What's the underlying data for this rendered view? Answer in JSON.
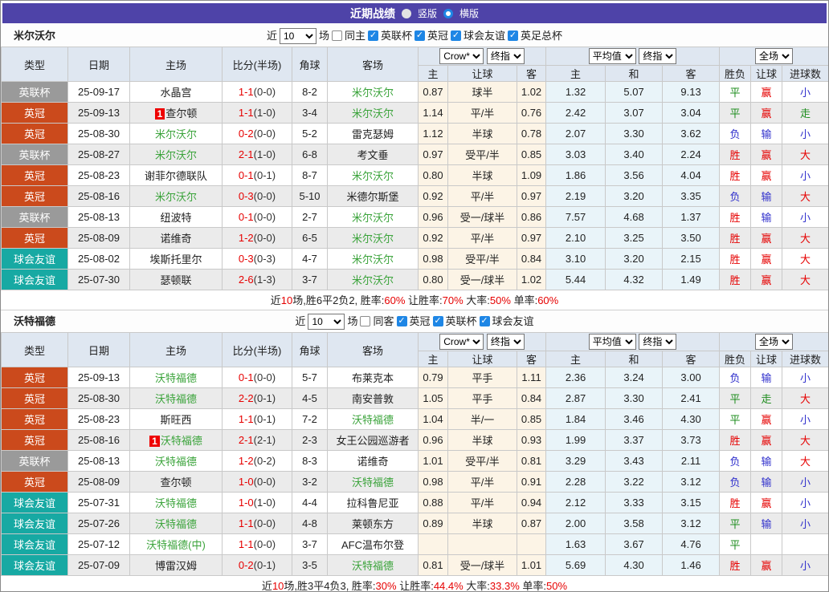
{
  "title_bar": {
    "title": "近期战绩",
    "radio_vertical": "竖版",
    "radio_horizontal": "横版"
  },
  "table_header": {
    "left_cols": [
      "类型",
      "日期",
      "主场",
      "比分(半场)",
      "角球",
      "客场"
    ],
    "handicap_selects": [
      "Crow*",
      "终指"
    ],
    "europe_selects": [
      "平均值",
      "终指"
    ],
    "scope_select": "全场",
    "sub_cols": [
      "主",
      "让球",
      "客",
      "主",
      "和",
      "客",
      "胜负",
      "让球",
      "进球数"
    ]
  },
  "colors": {
    "type_badges": {
      "英联杯": "#9A9A9A",
      "英冠": "#CB4A1C",
      "球会友谊": "#17A9A3"
    },
    "result": {
      "r": "#E60000",
      "g": "#1D8C1D",
      "b": "#3030CC"
    },
    "team_green": "#3AA33A",
    "score_red": "#E60000",
    "accent_purple": "#4E43A8"
  },
  "sections": [
    {
      "team": "米尔沃尔",
      "filter": {
        "near": "近",
        "count": "10",
        "games": "场",
        "same": "同主",
        "competitions": [
          "英联杯",
          "英冠",
          "球会友谊",
          "英足总杯"
        ]
      },
      "rows": [
        {
          "type": "英联杯",
          "date": "25-09-17",
          "home": "水晶宫",
          "home_focus": false,
          "home_badge": null,
          "score": "1-1",
          "half": "(0-0)",
          "corner": "8-2",
          "away": "米尔沃尔",
          "away_focus": true,
          "odds": [
            "0.87",
            "球半",
            "1.02"
          ],
          "euro": [
            "1.32",
            "5.07",
            "9.13"
          ],
          "results": [
            [
              "平",
              "g"
            ],
            [
              "赢",
              "r"
            ],
            [
              "小",
              "b"
            ]
          ]
        },
        {
          "type": "英冠",
          "date": "25-09-13",
          "home": "查尔顿",
          "home_focus": false,
          "home_badge": "1",
          "score": "1-1",
          "half": "(1-0)",
          "corner": "3-4",
          "away": "米尔沃尔",
          "away_focus": true,
          "odds": [
            "1.14",
            "平/半",
            "0.76"
          ],
          "euro": [
            "2.42",
            "3.07",
            "3.04"
          ],
          "results": [
            [
              "平",
              "g"
            ],
            [
              "赢",
              "r"
            ],
            [
              "走",
              "g"
            ]
          ]
        },
        {
          "type": "英冠",
          "date": "25-08-30",
          "home": "米尔沃尔",
          "home_focus": true,
          "home_badge": null,
          "score": "0-2",
          "half": "(0-0)",
          "corner": "5-2",
          "away": "雷克瑟姆",
          "away_focus": false,
          "odds": [
            "1.12",
            "半球",
            "0.78"
          ],
          "euro": [
            "2.07",
            "3.30",
            "3.62"
          ],
          "results": [
            [
              "负",
              "b"
            ],
            [
              "输",
              "b"
            ],
            [
              "小",
              "b"
            ]
          ]
        },
        {
          "type": "英联杯",
          "date": "25-08-27",
          "home": "米尔沃尔",
          "home_focus": true,
          "home_badge": null,
          "score": "2-1",
          "half": "(1-0)",
          "corner": "6-8",
          "away": "考文垂",
          "away_focus": false,
          "odds": [
            "0.97",
            "受平/半",
            "0.85"
          ],
          "euro": [
            "3.03",
            "3.40",
            "2.24"
          ],
          "results": [
            [
              "胜",
              "r"
            ],
            [
              "赢",
              "r"
            ],
            [
              "大",
              "r"
            ]
          ]
        },
        {
          "type": "英冠",
          "date": "25-08-23",
          "home": "谢菲尔德联队",
          "home_focus": false,
          "home_badge": null,
          "score": "0-1",
          "half": "(0-1)",
          "corner": "8-7",
          "away": "米尔沃尔",
          "away_focus": true,
          "odds": [
            "0.80",
            "半球",
            "1.09"
          ],
          "euro": [
            "1.86",
            "3.56",
            "4.04"
          ],
          "results": [
            [
              "胜",
              "r"
            ],
            [
              "赢",
              "r"
            ],
            [
              "小",
              "b"
            ]
          ]
        },
        {
          "type": "英冠",
          "date": "25-08-16",
          "home": "米尔沃尔",
          "home_focus": true,
          "home_badge": null,
          "score": "0-3",
          "half": "(0-0)",
          "corner": "5-10",
          "away": "米德尔斯堡",
          "away_focus": false,
          "odds": [
            "0.92",
            "平/半",
            "0.97"
          ],
          "euro": [
            "2.19",
            "3.20",
            "3.35"
          ],
          "results": [
            [
              "负",
              "b"
            ],
            [
              "输",
              "b"
            ],
            [
              "大",
              "r"
            ]
          ]
        },
        {
          "type": "英联杯",
          "date": "25-08-13",
          "home": "纽波特",
          "home_focus": false,
          "home_badge": null,
          "score": "0-1",
          "half": "(0-0)",
          "corner": "2-7",
          "away": "米尔沃尔",
          "away_focus": true,
          "odds": [
            "0.96",
            "受一/球半",
            "0.86"
          ],
          "euro": [
            "7.57",
            "4.68",
            "1.37"
          ],
          "results": [
            [
              "胜",
              "r"
            ],
            [
              "输",
              "b"
            ],
            [
              "小",
              "b"
            ]
          ]
        },
        {
          "type": "英冠",
          "date": "25-08-09",
          "home": "诺维奇",
          "home_focus": false,
          "home_badge": null,
          "score": "1-2",
          "half": "(0-0)",
          "corner": "6-5",
          "away": "米尔沃尔",
          "away_focus": true,
          "odds": [
            "0.92",
            "平/半",
            "0.97"
          ],
          "euro": [
            "2.10",
            "3.25",
            "3.50"
          ],
          "results": [
            [
              "胜",
              "r"
            ],
            [
              "赢",
              "r"
            ],
            [
              "大",
              "r"
            ]
          ]
        },
        {
          "type": "球会友谊",
          "date": "25-08-02",
          "home": "埃斯托里尔",
          "home_focus": false,
          "home_badge": null,
          "score": "0-3",
          "half": "(0-3)",
          "corner": "4-7",
          "away": "米尔沃尔",
          "away_focus": true,
          "odds": [
            "0.98",
            "受平/半",
            "0.84"
          ],
          "euro": [
            "3.10",
            "3.20",
            "2.15"
          ],
          "results": [
            [
              "胜",
              "r"
            ],
            [
              "赢",
              "r"
            ],
            [
              "大",
              "r"
            ]
          ]
        },
        {
          "type": "球会友谊",
          "date": "25-07-30",
          "home": "瑟顿联",
          "home_focus": false,
          "home_badge": null,
          "score": "2-6",
          "half": "(1-3)",
          "corner": "3-7",
          "away": "米尔沃尔",
          "away_focus": true,
          "odds": [
            "0.80",
            "受一/球半",
            "1.02"
          ],
          "euro": [
            "5.44",
            "4.32",
            "1.49"
          ],
          "results": [
            [
              "胜",
              "r"
            ],
            [
              "赢",
              "r"
            ],
            [
              "大",
              "r"
            ]
          ]
        }
      ],
      "summary": [
        [
          "近",
          0
        ],
        [
          "10",
          1
        ],
        [
          "场,胜6平2负2, 胜率:",
          0
        ],
        [
          "60%",
          1
        ],
        [
          " 让胜率:",
          0
        ],
        [
          "70%",
          1
        ],
        [
          " 大率:",
          0
        ],
        [
          "50%",
          1
        ],
        [
          " 单率:",
          0
        ],
        [
          "60%",
          1
        ]
      ]
    },
    {
      "team": "沃特福德",
      "filter": {
        "near": "近",
        "count": "10",
        "games": "场",
        "same": "同客",
        "competitions": [
          "英冠",
          "英联杯",
          "球会友谊"
        ]
      },
      "rows": [
        {
          "type": "英冠",
          "date": "25-09-13",
          "home": "沃特福德",
          "home_focus": true,
          "home_badge": null,
          "score": "0-1",
          "half": "(0-0)",
          "corner": "5-7",
          "away": "布莱克本",
          "away_focus": false,
          "odds": [
            "0.79",
            "平手",
            "1.11"
          ],
          "euro": [
            "2.36",
            "3.24",
            "3.00"
          ],
          "results": [
            [
              "负",
              "b"
            ],
            [
              "输",
              "b"
            ],
            [
              "小",
              "b"
            ]
          ]
        },
        {
          "type": "英冠",
          "date": "25-08-30",
          "home": "沃特福德",
          "home_focus": true,
          "home_badge": null,
          "score": "2-2",
          "half": "(0-1)",
          "corner": "4-5",
          "away": "南安普敦",
          "away_focus": false,
          "odds": [
            "1.05",
            "平手",
            "0.84"
          ],
          "euro": [
            "2.87",
            "3.30",
            "2.41"
          ],
          "results": [
            [
              "平",
              "g"
            ],
            [
              "走",
              "g"
            ],
            [
              "大",
              "r"
            ]
          ]
        },
        {
          "type": "英冠",
          "date": "25-08-23",
          "home": "斯旺西",
          "home_focus": false,
          "home_badge": null,
          "score": "1-1",
          "half": "(0-1)",
          "corner": "7-2",
          "away": "沃特福德",
          "away_focus": true,
          "odds": [
            "1.04",
            "半/一",
            "0.85"
          ],
          "euro": [
            "1.84",
            "3.46",
            "4.30"
          ],
          "results": [
            [
              "平",
              "g"
            ],
            [
              "赢",
              "r"
            ],
            [
              "小",
              "b"
            ]
          ]
        },
        {
          "type": "英冠",
          "date": "25-08-16",
          "home": "沃特福德",
          "home_focus": true,
          "home_badge": "1",
          "score": "2-1",
          "half": "(2-1)",
          "corner": "2-3",
          "away": "女王公园巡游者",
          "away_focus": false,
          "odds": [
            "0.96",
            "半球",
            "0.93"
          ],
          "euro": [
            "1.99",
            "3.37",
            "3.73"
          ],
          "results": [
            [
              "胜",
              "r"
            ],
            [
              "赢",
              "r"
            ],
            [
              "大",
              "r"
            ]
          ]
        },
        {
          "type": "英联杯",
          "date": "25-08-13",
          "home": "沃特福德",
          "home_focus": true,
          "home_badge": null,
          "score": "1-2",
          "half": "(0-2)",
          "corner": "8-3",
          "away": "诺维奇",
          "away_focus": false,
          "odds": [
            "1.01",
            "受平/半",
            "0.81"
          ],
          "euro": [
            "3.29",
            "3.43",
            "2.11"
          ],
          "results": [
            [
              "负",
              "b"
            ],
            [
              "输",
              "b"
            ],
            [
              "大",
              "r"
            ]
          ]
        },
        {
          "type": "英冠",
          "date": "25-08-09",
          "home": "查尔顿",
          "home_focus": false,
          "home_badge": null,
          "score": "1-0",
          "half": "(0-0)",
          "corner": "3-2",
          "away": "沃特福德",
          "away_focus": true,
          "odds": [
            "0.98",
            "平/半",
            "0.91"
          ],
          "euro": [
            "2.28",
            "3.22",
            "3.12"
          ],
          "results": [
            [
              "负",
              "b"
            ],
            [
              "输",
              "b"
            ],
            [
              "小",
              "b"
            ]
          ]
        },
        {
          "type": "球会友谊",
          "date": "25-07-31",
          "home": "沃特福德",
          "home_focus": true,
          "home_badge": null,
          "score": "1-0",
          "half": "(1-0)",
          "corner": "4-4",
          "away": "拉科鲁尼亚",
          "away_focus": false,
          "odds": [
            "0.88",
            "平/半",
            "0.94"
          ],
          "euro": [
            "2.12",
            "3.33",
            "3.15"
          ],
          "results": [
            [
              "胜",
              "r"
            ],
            [
              "赢",
              "r"
            ],
            [
              "小",
              "b"
            ]
          ]
        },
        {
          "type": "球会友谊",
          "date": "25-07-26",
          "home": "沃特福德",
          "home_focus": true,
          "home_badge": null,
          "score": "1-1",
          "half": "(0-0)",
          "corner": "4-8",
          "away": "莱顿东方",
          "away_focus": false,
          "odds": [
            "0.89",
            "半球",
            "0.87"
          ],
          "euro": [
            "2.00",
            "3.58",
            "3.12"
          ],
          "results": [
            [
              "平",
              "g"
            ],
            [
              "输",
              "b"
            ],
            [
              "小",
              "b"
            ]
          ]
        },
        {
          "type": "球会友谊",
          "date": "25-07-12",
          "home": "沃特福德(中)",
          "home_focus": true,
          "home_badge": null,
          "score": "1-1",
          "half": "(0-0)",
          "corner": "3-7",
          "away": "AFC温布尔登",
          "away_focus": false,
          "odds": [
            "",
            "",
            ""
          ],
          "euro": [
            "1.63",
            "3.67",
            "4.76"
          ],
          "results": [
            [
              "平",
              "g"
            ],
            [
              "",
              ""
            ],
            [
              "",
              ""
            ]
          ]
        },
        {
          "type": "球会友谊",
          "date": "25-07-09",
          "home": "博雷汉姆",
          "home_focus": false,
          "home_badge": null,
          "score": "0-2",
          "half": "(0-1)",
          "corner": "3-5",
          "away": "沃特福德",
          "away_focus": true,
          "odds": [
            "0.81",
            "受一/球半",
            "1.01"
          ],
          "euro": [
            "5.69",
            "4.30",
            "1.46"
          ],
          "results": [
            [
              "胜",
              "r"
            ],
            [
              "赢",
              "r"
            ],
            [
              "小",
              "b"
            ]
          ]
        }
      ],
      "summary": [
        [
          "近",
          0
        ],
        [
          "10",
          1
        ],
        [
          "场,胜3平4负3, 胜率:",
          0
        ],
        [
          "30%",
          1
        ],
        [
          " 让胜率:",
          0
        ],
        [
          "44.4%",
          1
        ],
        [
          " 大率:",
          0
        ],
        [
          "33.3%",
          1
        ],
        [
          " 单率:",
          0
        ],
        [
          "50%",
          1
        ]
      ]
    }
  ]
}
